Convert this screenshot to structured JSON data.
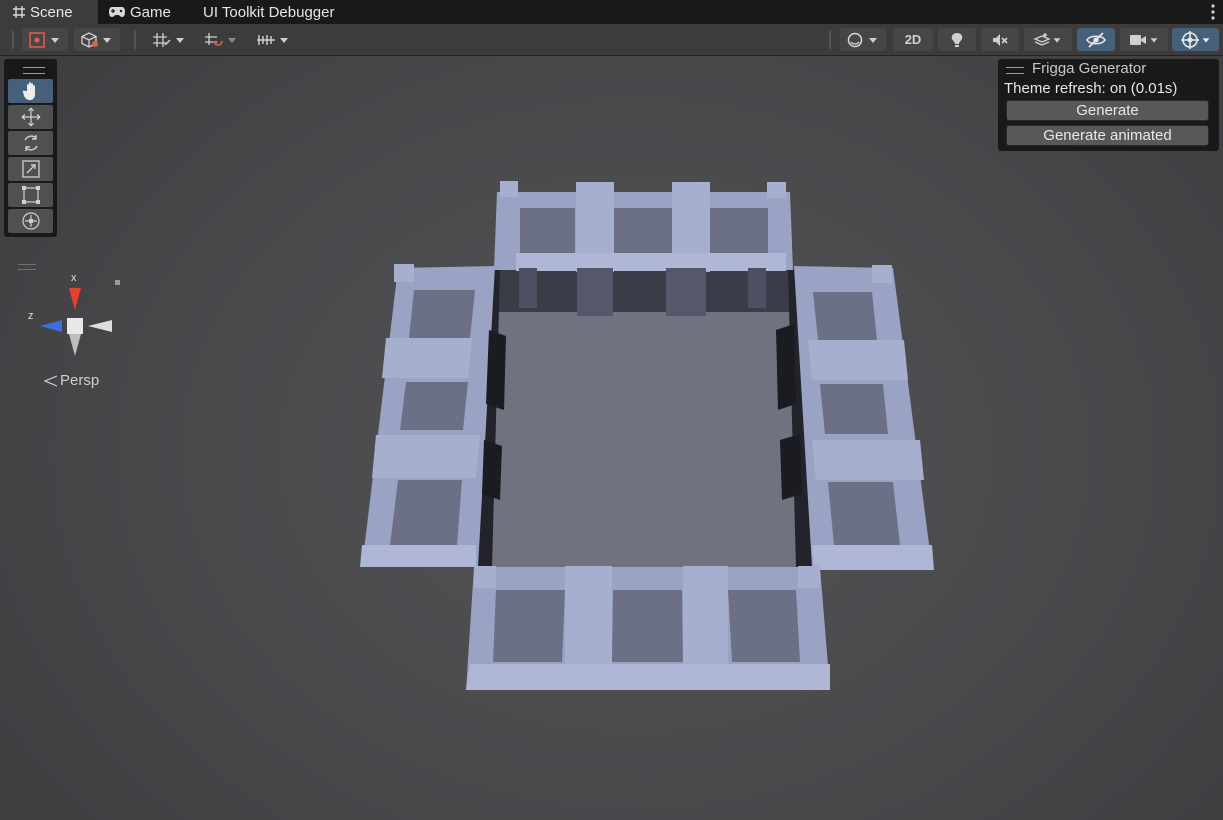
{
  "tabs": [
    {
      "label": "Scene",
      "icon": "scene-grid-icon",
      "active": true
    },
    {
      "label": "Game",
      "icon": "gamepad-icon",
      "active": false
    },
    {
      "label": "UI Toolkit Debugger",
      "active": false
    }
  ],
  "toolbar": {
    "toggle_2d_label": "2D"
  },
  "tools": [
    {
      "name": "hand-tool",
      "icon": "hand-icon",
      "active": true
    },
    {
      "name": "move-tool",
      "icon": "move-arrows-icon",
      "active": false
    },
    {
      "name": "rotate-tool",
      "icon": "rotate-icon",
      "active": false
    },
    {
      "name": "scale-tool",
      "icon": "scale-icon",
      "active": false
    },
    {
      "name": "rect-tool",
      "icon": "rect-transform-icon",
      "active": false
    },
    {
      "name": "transform-tool",
      "icon": "transform-icon",
      "active": false
    }
  ],
  "gizmo": {
    "x_label": "x",
    "z_label": "z",
    "projection_label": "Persp"
  },
  "overlay": {
    "title": "Frigga Generator",
    "theme_refresh": "Theme refresh: on (0.01s)",
    "generate_label": "Generate",
    "generate_animated_label": "Generate animated"
  },
  "colors": {
    "accent": "#46607c",
    "x_axis": "#e5412e",
    "z_axis": "#3b6fe0",
    "walls": "#9aa3c4",
    "floor": "#70727f"
  }
}
